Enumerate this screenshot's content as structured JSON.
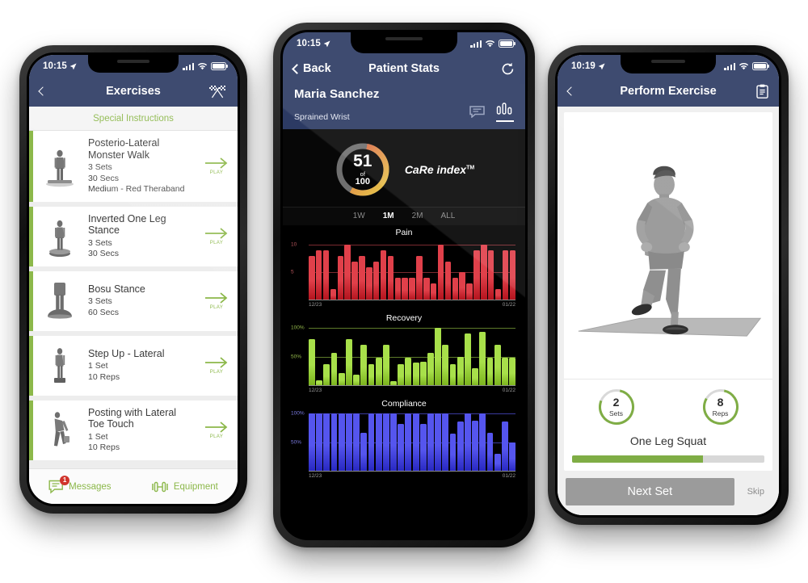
{
  "left_phone": {
    "status": {
      "time": "10:15",
      "location_icon": "location-arrow-icon"
    },
    "nav": {
      "back_icon": "chevron-left-icon",
      "title": "Exercises",
      "right_icon": "checkered-flags-icon"
    },
    "special_instructions": "Special Instructions",
    "exercises": [
      {
        "name": "Posterio-Lateral Monster Walk",
        "meta": [
          "3 Sets",
          "30 Secs",
          "Medium - Red Theraband"
        ],
        "play_label": "PLAY"
      },
      {
        "name": "Inverted One Leg Stance",
        "meta": [
          "3 Sets",
          "30 Secs"
        ],
        "play_label": "PLAY"
      },
      {
        "name": "Bosu Stance",
        "meta": [
          "3 Sets",
          "60 Secs"
        ],
        "play_label": "PLAY"
      },
      {
        "name": "Step Up - Lateral",
        "meta": [
          "1 Set",
          "10 Reps"
        ],
        "play_label": "PLAY"
      },
      {
        "name": "Posting with Lateral Toe Touch",
        "meta": [
          "1 Set",
          "10 Reps"
        ],
        "play_label": "PLAY"
      }
    ],
    "tabs": [
      {
        "label": "Messages",
        "icon": "message-icon",
        "badge": "1"
      },
      {
        "label": "Equipment",
        "icon": "dumbbell-icon",
        "badge": ""
      }
    ]
  },
  "center_phone": {
    "status": {
      "time": "10:15",
      "location_icon": "location-arrow-icon"
    },
    "nav": {
      "back_label": "Back",
      "title": "Patient Stats",
      "refresh_icon": "refresh-icon"
    },
    "patient": {
      "name": "Maria Sanchez",
      "condition": "Sprained Wrist",
      "chat_icon": "chat-bubble-icon",
      "stats_icon": "bar-chart-icon"
    },
    "care_index": {
      "value": "51",
      "of": "of",
      "max": "100",
      "label": "CaRe index",
      "tm": "TM",
      "percent": 51,
      "colors": [
        "#6f6f6f",
        "#d0453f",
        "#e08a4a",
        "#e6c04a"
      ]
    },
    "range_tabs": [
      {
        "label": "1W",
        "active": false
      },
      {
        "label": "1M",
        "active": true
      },
      {
        "label": "2M",
        "active": false
      },
      {
        "label": "ALL",
        "active": false
      }
    ],
    "chart_data": [
      {
        "type": "bar",
        "title": "Pain",
        "color": "#e0404a",
        "xlabel": "",
        "ylabel": "",
        "x_start": "12/23",
        "x_end": "01/22",
        "ylim": [
          0,
          11
        ],
        "yticks": [
          5,
          10
        ],
        "ytick_labels": [
          "5",
          "10"
        ],
        "grid": true,
        "values": [
          8,
          9,
          9,
          2,
          8,
          10,
          7,
          8,
          6,
          7,
          9,
          8,
          4,
          4,
          4,
          8,
          4,
          3,
          10,
          7,
          4,
          5,
          3,
          9,
          10,
          9,
          2,
          9,
          9
        ]
      },
      {
        "type": "bar",
        "title": "Recovery",
        "color": "#a8e04a",
        "xlabel": "",
        "ylabel": "",
        "x_start": "12/23",
        "x_end": "01/22",
        "ylim": [
          0,
          105
        ],
        "yticks": [
          50,
          100
        ],
        "ytick_labels": [
          "50%",
          "100%"
        ],
        "grid": true,
        "values": [
          80,
          10,
          38,
          57,
          22,
          80,
          20,
          70,
          38,
          48,
          70,
          8,
          38,
          48,
          40,
          42,
          57,
          100,
          70,
          38,
          50,
          90,
          30,
          92,
          48,
          70,
          48,
          48
        ]
      },
      {
        "type": "bar",
        "title": "Compliance",
        "color": "#5555ee",
        "xlabel": "",
        "ylabel": "",
        "x_start": "12/23",
        "x_end": "01/22",
        "ylim": [
          0,
          105
        ],
        "yticks": [
          50,
          100
        ],
        "ytick_labels": [
          "50%",
          "100%"
        ],
        "grid": true,
        "values": [
          100,
          100,
          100,
          100,
          100,
          100,
          100,
          67,
          100,
          100,
          100,
          100,
          82,
          100,
          100,
          82,
          100,
          100,
          100,
          65,
          85,
          100,
          87,
          100,
          67,
          30,
          85,
          50
        ]
      }
    ]
  },
  "right_phone": {
    "status": {
      "time": "10:19",
      "location_icon": "location-arrow-icon"
    },
    "nav": {
      "back_icon": "chevron-left-icon",
      "title": "Perform Exercise",
      "right_icon": "clipboard-icon"
    },
    "counters": [
      {
        "num": "2",
        "label": "Sets",
        "ring_percent": 78
      },
      {
        "num": "8",
        "label": "Reps",
        "ring_percent": 80
      }
    ],
    "exercise_title": "One Leg Squat",
    "progress_percent": 68,
    "next_label": "Next Set",
    "skip_label": "Skip"
  },
  "colors": {
    "navy": "#2c3a63",
    "green": "#8cb84a",
    "red": "#d0342c"
  }
}
